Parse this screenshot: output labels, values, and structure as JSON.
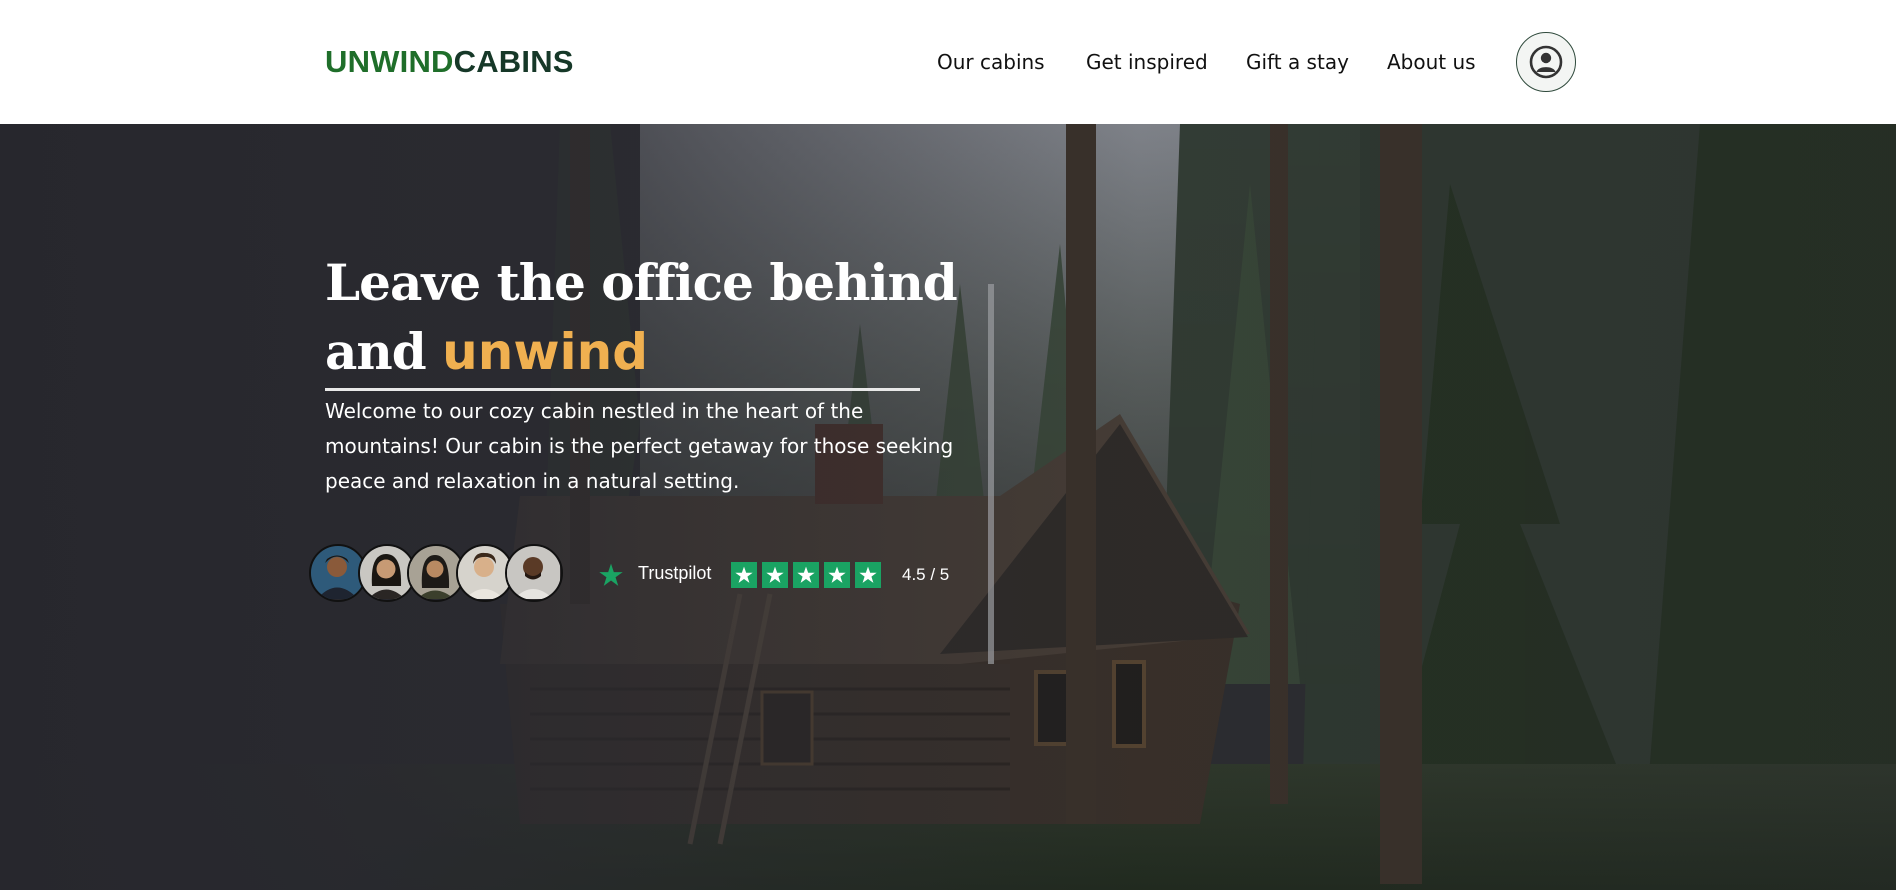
{
  "brand": {
    "part1": "UNWIND",
    "part2": "CABINS",
    "color1": "#1f6e2a",
    "color2": "#163828"
  },
  "nav": {
    "items": [
      {
        "label": "Our cabins"
      },
      {
        "label": "Get inspired"
      },
      {
        "label": "Gift a stay"
      },
      {
        "label": "About us"
      }
    ],
    "account_icon": "user-circle-icon"
  },
  "hero": {
    "background": "forest-cabin-photo",
    "headline_part1": "Leave the office behind",
    "headline_part2": "and",
    "headline_accent": "unwind",
    "accent_color": "#f0b050",
    "intro": "Welcome to our cozy cabin nestled in the heart of the mountains! Our cabin is the perfect getaway for those seeking peace and relaxation in a natural setting."
  },
  "social_proof": {
    "avatars": [
      {
        "icon": "guest-avatar-1"
      },
      {
        "icon": "guest-avatar-2"
      },
      {
        "icon": "guest-avatar-3"
      },
      {
        "icon": "guest-avatar-4"
      },
      {
        "icon": "guest-avatar-5"
      }
    ],
    "trustpilot_label": "Trustpilot",
    "star_color": "#1aa363",
    "rating_value": 4.5,
    "rating_max": 5,
    "rating_text": "4.5 / 5"
  }
}
